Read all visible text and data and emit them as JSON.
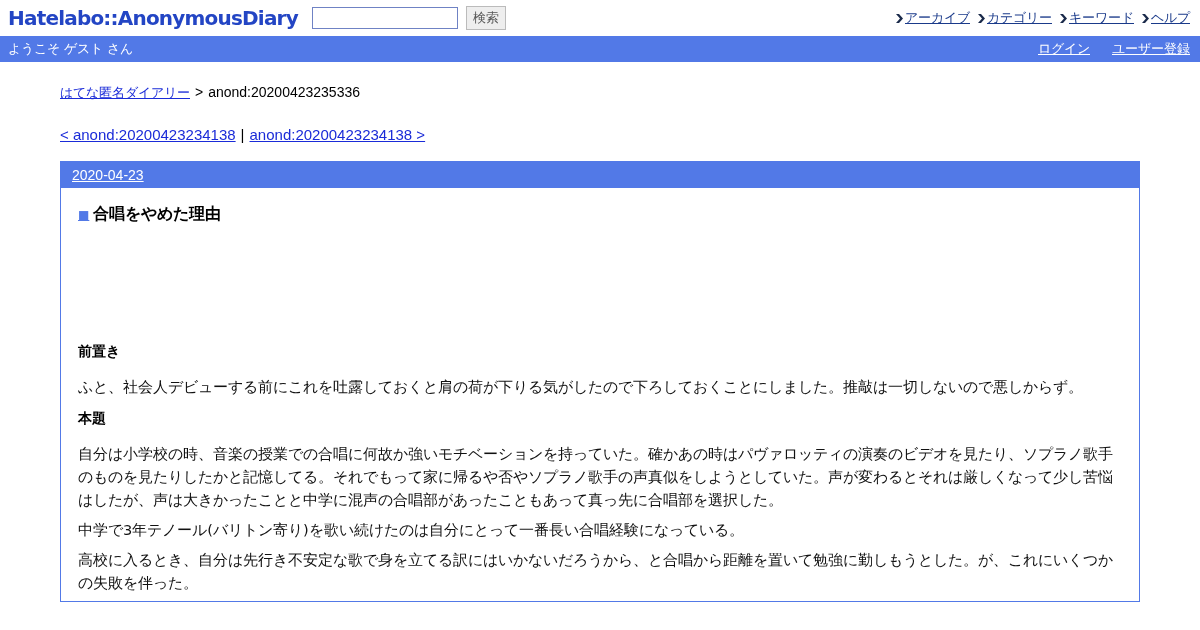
{
  "header": {
    "logo": "Hatelabo::AnonymousDiary",
    "search_button": "検索",
    "nav": [
      "アーカイブ",
      "カテゴリー",
      "キーワード",
      "ヘルプ"
    ]
  },
  "user_bar": {
    "welcome": "ようこそ ゲスト さん",
    "links": [
      "ログイン",
      "ユーザー登録"
    ]
  },
  "breadcrumb": {
    "link": "はてな匿名ダイアリー",
    "separator": ">",
    "current": "anond:20200423235336"
  },
  "pager": {
    "prev": "< anond:20200423234138",
    "separator": "|",
    "next": "anond:20200423234138 >"
  },
  "day": {
    "date": "2020-04-23",
    "title_mark": "■",
    "title": "合唱をやめた理由",
    "blocks": [
      {
        "kind": "heading",
        "text": "前置き"
      },
      {
        "kind": "para",
        "text": "ふと、社会人デビューする前にこれを吐露しておくと肩の荷が下りる気がしたので下ろしておくことにしました。推敲は一切しないので悪しからず。"
      },
      {
        "kind": "heading",
        "text": "本題"
      },
      {
        "kind": "para",
        "text": "自分は小学校の時、音楽の授業での合唱に何故か強いモチベーションを持っていた。確かあの時はパヴァロッティの演奏のビデオを見たり、ソプラノ歌手のものを見たりしたかと記憶してる。それでもって家に帰るや否やソプラノ歌手の声真似をしようとしていた。声が変わるとそれは厳しくなって少し苦悩はしたが、声は大きかったことと中学に混声の合唱部があったこともあって真っ先に合唱部を選択した。"
      },
      {
        "kind": "para",
        "text": "中学で3年テノール(バリトン寄り)を歌い続けたのは自分にとって一番長い合唱経験になっている。"
      },
      {
        "kind": "para",
        "text": "高校に入るとき、自分は先行き不安定な歌で身を立てる訳にはいかないだろうから、と合唱から距離を置いて勉強に勤しもうとした。が、これにいくつかの失敗を伴った。"
      }
    ]
  }
}
